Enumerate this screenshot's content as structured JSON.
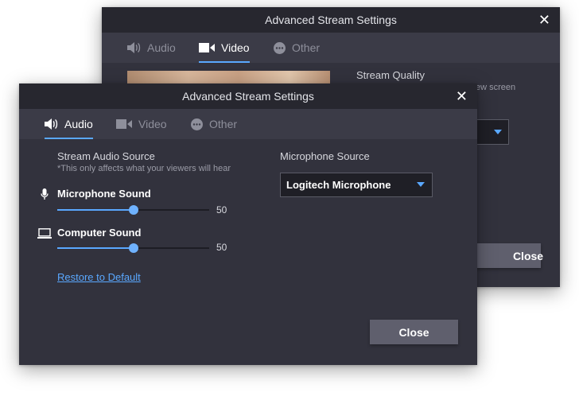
{
  "back_window": {
    "title": "Advanced Stream Settings",
    "tabs": [
      {
        "label": "Audio",
        "icon": "speaker-icon"
      },
      {
        "label": "Video",
        "icon": "camera-icon"
      },
      {
        "label": "Other",
        "icon": "more-icon"
      }
    ],
    "active_tab": "Video",
    "stream_quality_label": "Stream Quality",
    "partial_text": "ew screen",
    "close_button": "Close"
  },
  "front_window": {
    "title": "Advanced Stream Settings",
    "tabs": [
      {
        "label": "Audio",
        "icon": "speaker-icon"
      },
      {
        "label": "Video",
        "icon": "camera-icon"
      },
      {
        "label": "Other",
        "icon": "more-icon"
      }
    ],
    "active_tab": "Audio",
    "stream_audio_source": "Stream Audio Source",
    "stream_audio_note": "*This only affects what your viewers will hear",
    "microphone_sound": {
      "label": "Microphone Sound",
      "value": "50",
      "percent": 50
    },
    "computer_sound": {
      "label": "Computer Sound",
      "value": "50",
      "percent": 50
    },
    "restore_link": "Restore to Default",
    "microphone_source_label": "Microphone Source",
    "microphone_source_value": "Logitech Microphone",
    "close_button": "Close"
  },
  "colors": {
    "accent": "#5aa8ff",
    "window_bg": "#32323d",
    "titlebar_bg": "#27272f",
    "tabbar_bg": "#3b3b47"
  }
}
